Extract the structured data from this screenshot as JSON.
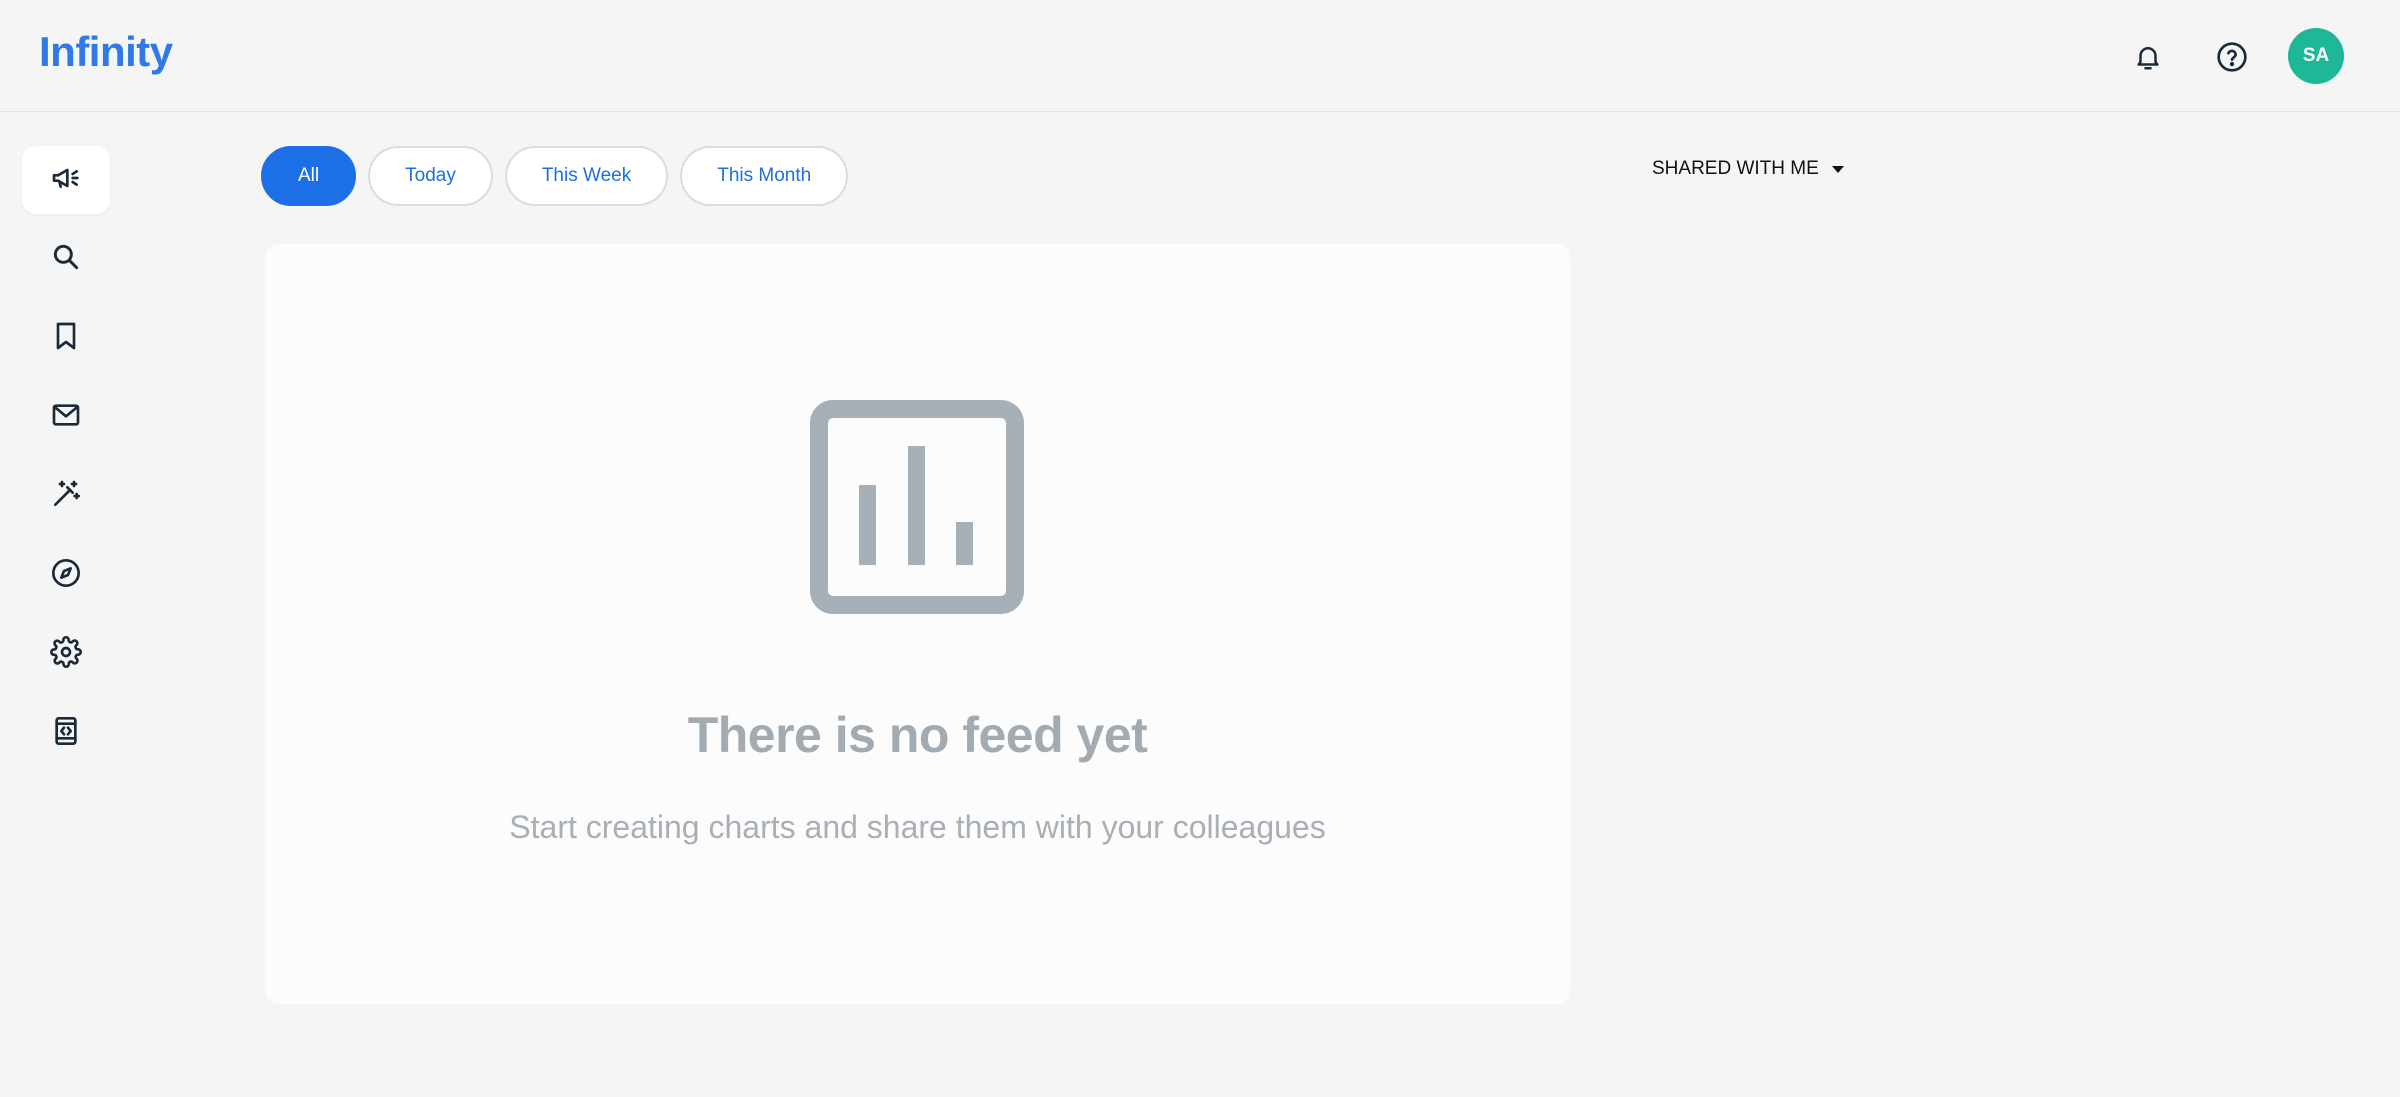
{
  "app": {
    "title": "Infinity"
  },
  "header": {
    "notifications_icon": "bell-icon",
    "help_icon": "help-circle-icon",
    "avatar_initials": "SA",
    "avatar_color": "#1fb897"
  },
  "sidebar": {
    "items": [
      {
        "icon": "megaphone-icon",
        "active": true
      },
      {
        "icon": "search-icon",
        "active": false
      },
      {
        "icon": "bookmark-icon",
        "active": false
      },
      {
        "icon": "mail-icon",
        "active": false
      },
      {
        "icon": "magic-wand-icon",
        "active": false
      },
      {
        "icon": "compass-icon",
        "active": false
      },
      {
        "icon": "gear-icon",
        "active": false
      },
      {
        "icon": "code-device-icon",
        "active": false
      }
    ]
  },
  "filters": {
    "items": [
      {
        "label": "All",
        "active": true
      },
      {
        "label": "Today",
        "active": false
      },
      {
        "label": "This Week",
        "active": false
      },
      {
        "label": "This Month",
        "active": false
      }
    ]
  },
  "shared_dropdown": {
    "label": "SHARED WITH ME",
    "icon": "caret-down-icon"
  },
  "empty_state": {
    "icon": "bar-chart-icon",
    "title": "There is no feed yet",
    "subtitle": "Start creating charts and share them with your colleagues"
  },
  "colors": {
    "brand": "#2f7ae5",
    "accent": "#1d6fe6",
    "muted_text": "#a3abb2",
    "empty_icon": "#a7b0b6"
  }
}
